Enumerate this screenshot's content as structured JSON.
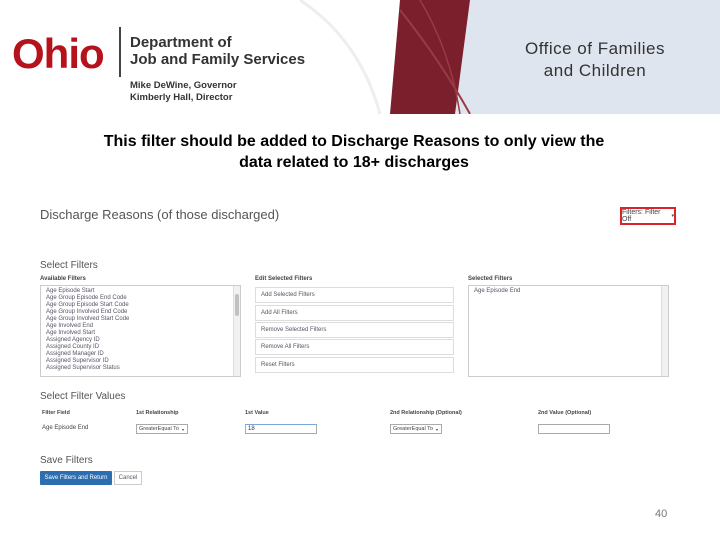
{
  "header": {
    "logo_o": "O",
    "logo_rest": "hio",
    "department_line1": "Department of",
    "department_line2": "Job and Family Services",
    "governor": "Mike DeWine, Governor",
    "director": "Kimberly Hall, Director",
    "office_line1": "Office of Families",
    "office_line2": "and Children",
    "brand_color": "#b5121b",
    "stripe_color": "#7a1f2b"
  },
  "caption": {
    "line1": "This filter should be added to Discharge Reasons to only view the",
    "line2": "data related to 18+ discharges"
  },
  "report": {
    "title": "Discharge Reasons (of those discharged)",
    "filter_button": "Filters: Filter Off",
    "filter_caret": "▾",
    "highlight_color": "#d9242b"
  },
  "select_filters": {
    "title": "Select Filters",
    "available_label": "Available Filters",
    "available_items": [
      "Age Episode Start",
      "Age Group Episode End Code",
      "Age Group Episode Start Code",
      "Age Group Involved End Code",
      "Age Group Involved Start Code",
      "Age Involved End",
      "Age Involved Start",
      "Assigned Agency ID",
      "Assigned County ID",
      "Assigned Manager ID",
      "Assigned Supervisor ID",
      "Assigned Supervisor Status"
    ],
    "edit_label": "Edit Selected Filters",
    "edit_buttons": [
      "Add Selected Filters",
      "Add All Filters",
      "Remove Selected Filters",
      "Remove All Filters",
      "Reset Filters"
    ],
    "selected_label": "Selected Filters",
    "selected_items": [
      "Age Episode End"
    ]
  },
  "filter_values": {
    "title": "Select Filter Values",
    "headers": {
      "field": "Filter Field",
      "rel1": "1st Relationship",
      "val1": "1st Value",
      "rel2": "2nd Relationship (Optional)",
      "val2": "2nd Value (Optional)"
    },
    "row": {
      "field": "Age Episode End",
      "rel1": "GreaterEqual To",
      "val1": "18",
      "rel2": "GreaterEqual To",
      "val2": ""
    },
    "arrow": "▾"
  },
  "save_filters": {
    "title": "Save Filters",
    "save_button": "Save Filters and Return",
    "cancel_button": "Cancel",
    "accent": "#2c6eaf"
  },
  "page_number": "40"
}
